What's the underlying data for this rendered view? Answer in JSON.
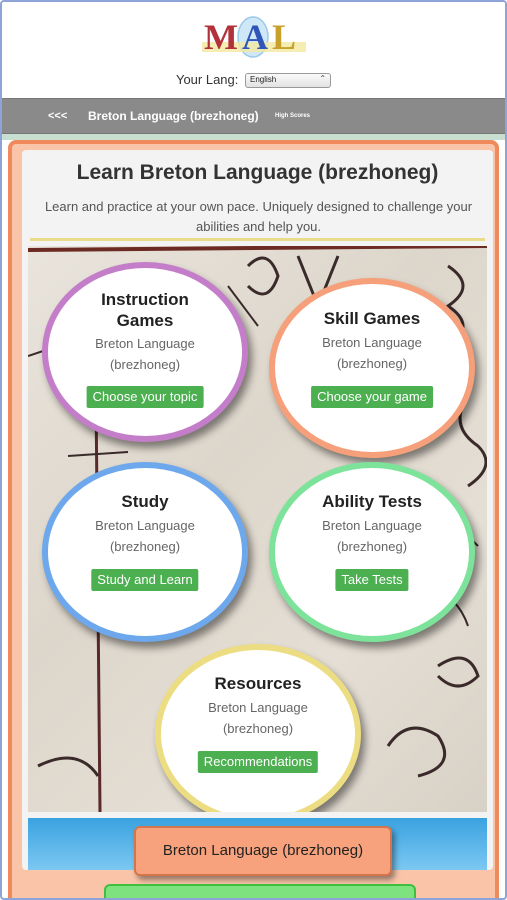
{
  "header": {
    "logo_letters": [
      "M",
      "A",
      "L"
    ],
    "lang_label": "Your Lang:",
    "lang_selected": "English"
  },
  "nav": {
    "back": "<<<",
    "title": "Breton Language (brezhoneg)",
    "high_scores": "High Scores"
  },
  "main": {
    "title": "Learn Breton Language (brezhoneg)",
    "subtitle": "Learn and practice at your own pace. Uniquely designed to challenge your abilities and help you.",
    "tiles": [
      {
        "title_line1": "Instruction",
        "title_line2": "Games",
        "lang_line1": "Breton Language",
        "lang_line2": "(brezhoneg)",
        "button": "Choose your topic",
        "color": "#c47ec9"
      },
      {
        "title_line1": "Skill Games",
        "lang_line1": "Breton Language",
        "lang_line2": "(brezhoneg)",
        "button": "Choose your game",
        "color": "#f5a07a"
      },
      {
        "title_line1": "Study",
        "lang_line1": "Breton Language",
        "lang_line2": "(brezhoneg)",
        "button": "Study and Learn",
        "color": "#6ea8ec"
      },
      {
        "title_line1": "Ability Tests",
        "lang_line1": "Breton Language",
        "lang_line2": "(brezhoneg)",
        "button": "Take Tests",
        "color": "#7ee39a"
      },
      {
        "title_line1": "Resources",
        "lang_line1": "Breton Language",
        "lang_line2": "(brezhoneg)",
        "button": "Recommendations",
        "color": "#ecdc82"
      }
    ]
  },
  "bottom": {
    "button": "Breton Language (brezhoneg)"
  },
  "colors": {
    "nav_bg": "#8a8a8a",
    "outer_border": "#f08a5c",
    "button_green": "#4caf50"
  }
}
